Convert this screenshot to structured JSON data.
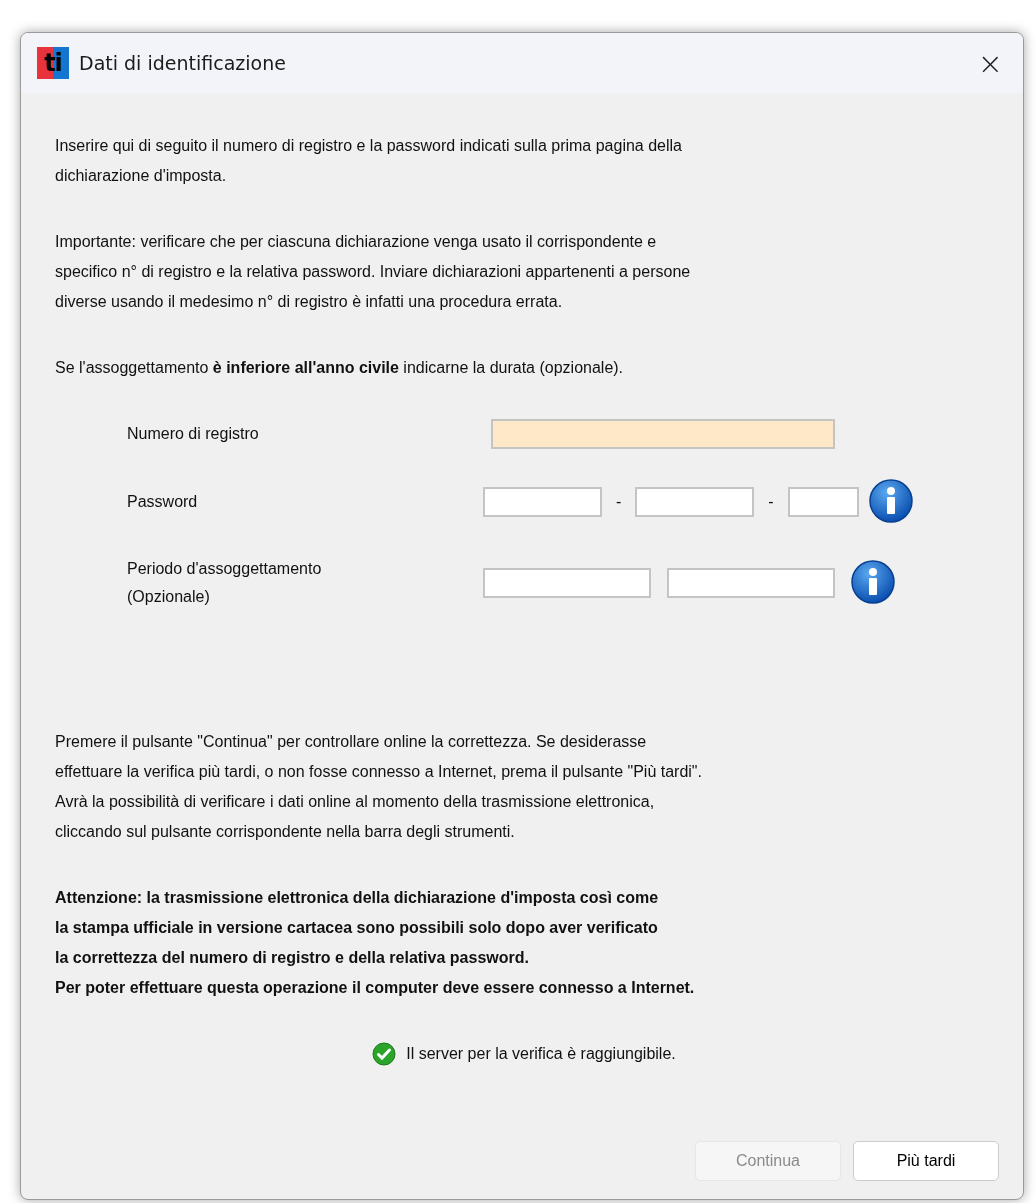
{
  "window": {
    "logo": "ti",
    "title": "Dati di identificazione",
    "close": "×"
  },
  "paragraphs": [
    "Inserire qui di seguito il numero di registro e la password indicati sulla prima pagina della\ndichiarazione d'imposta.",
    "Importante: verificare che per ciascuna dichiarazione venga usato il corrispondente e\nspecifico n° di registro e la relativa password. Inviare dichiarazioni appartenenti a persone\ndiverse usando il medesimo n° di registro è infatti una procedura errata.",
    "Se l'assoggettamento **è inferiore all'anno civile** indicarne la durata (opzionale)."
  ],
  "form": [
    {
      "label": "Numero di registro",
      "info": false,
      "parts": [
        {
          "kind": "field",
          "highlighted": true
        }
      ]
    },
    {
      "label": "Password",
      "info": true,
      "parts": [
        {
          "kind": "field",
          "highlighted": false
        },
        {
          "kind": "separator",
          "text": "-"
        },
        {
          "kind": "field",
          "highlighted": false
        },
        {
          "kind": "separator",
          "text": "-"
        },
        {
          "kind": "field",
          "highlighted": false
        }
      ]
    },
    {
      "label": "Periodo d'assoggettamento\n(Opzionale)",
      "info": true,
      "parts": [
        {
          "kind": "field",
          "highlighted": false
        },
        {
          "kind": "field",
          "highlighted": false
        }
      ]
    }
  ],
  "instructions": "Premere il pulsante \"Continua\" per controllare online la correttezza. Se desiderasse\neffettuare la verifica più tardi, o non fosse connesso a Internet, prema il pulsante \"Più tardi\".\nAvrà la possibilità di verificare i dati online al momento della trasmissione elettronica,\ncliccando sul pulsante corrispondente nella barra degli strumenti.",
  "warning": "Attenzione: la trasmissione elettronica della dichiarazione d'imposta così come\nla stampa ufficiale in versione cartacea sono possibili solo dopo aver verificato\nla correttezza del numero di registro e della relativa password.\nPer poter effettuare questa operazione il computer deve essere connesso a Internet.",
  "status": {
    "ok": true,
    "text": "Il server per la verifica è raggiungibile."
  },
  "buttons": [
    {
      "label": "Continua",
      "disabled": true
    },
    {
      "label": "Più tardi",
      "disabled": false
    }
  ]
}
